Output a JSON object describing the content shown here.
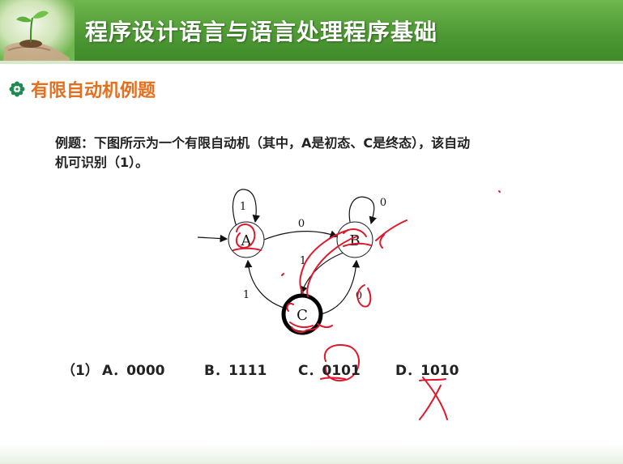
{
  "header": {
    "title": "程序设计语言与语言处理程序基础",
    "icon": "seedling-in-hands"
  },
  "section": {
    "bullet_icon": "flower-bullet-icon",
    "title": "有限自动机例题"
  },
  "question": {
    "line1": "例题：下图所示为一个有限自动机（其中，A是初态、C是终态），该自动",
    "line2": "机可识别（1）。"
  },
  "automaton": {
    "states": [
      "A",
      "B",
      "C"
    ],
    "initial": "A",
    "final": "C",
    "transitions": [
      {
        "from": "A",
        "to": "A",
        "label": "1"
      },
      {
        "from": "A",
        "to": "B",
        "label": "0"
      },
      {
        "from": "B",
        "to": "B",
        "label": "0"
      },
      {
        "from": "B",
        "to": "C",
        "label": "1"
      },
      {
        "from": "C",
        "to": "A",
        "label": "1"
      },
      {
        "from": "C",
        "to": "B",
        "label": "0"
      }
    ]
  },
  "options": {
    "number": "（1）",
    "a": "A．0000",
    "b": "B．1111",
    "c": "C．0101",
    "d": "D．1010"
  },
  "colors": {
    "header_green": "#4f9a35",
    "section_orange": "#e36f1f",
    "annotation_red": "#e0182a"
  }
}
